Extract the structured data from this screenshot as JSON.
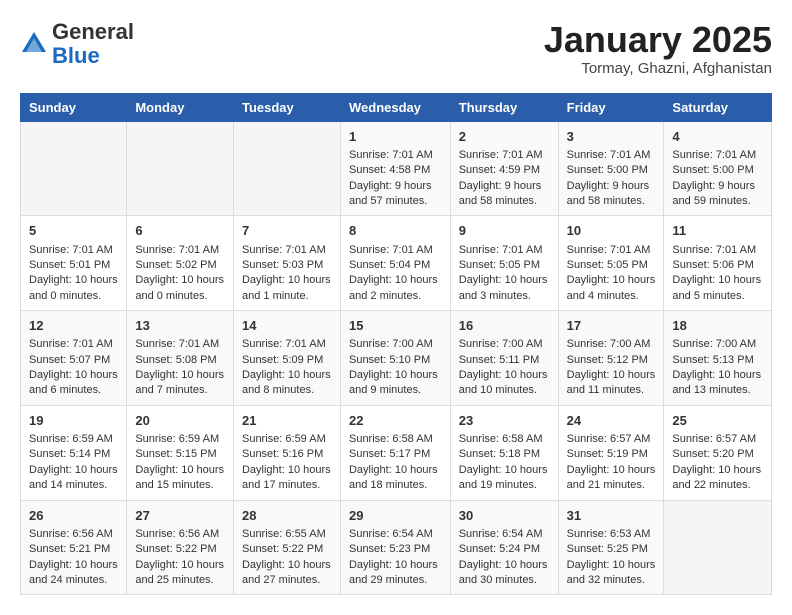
{
  "header": {
    "logo_line1": "General",
    "logo_line2": "Blue",
    "month_title": "January 2025",
    "location": "Tormay, Ghazni, Afghanistan"
  },
  "weekdays": [
    "Sunday",
    "Monday",
    "Tuesday",
    "Wednesday",
    "Thursday",
    "Friday",
    "Saturday"
  ],
  "weeks": [
    [
      {
        "day": "",
        "content": ""
      },
      {
        "day": "",
        "content": ""
      },
      {
        "day": "",
        "content": ""
      },
      {
        "day": "1",
        "content": "Sunrise: 7:01 AM\nSunset: 4:58 PM\nDaylight: 9 hours and 57 minutes."
      },
      {
        "day": "2",
        "content": "Sunrise: 7:01 AM\nSunset: 4:59 PM\nDaylight: 9 hours and 58 minutes."
      },
      {
        "day": "3",
        "content": "Sunrise: 7:01 AM\nSunset: 5:00 PM\nDaylight: 9 hours and 58 minutes."
      },
      {
        "day": "4",
        "content": "Sunrise: 7:01 AM\nSunset: 5:00 PM\nDaylight: 9 hours and 59 minutes."
      }
    ],
    [
      {
        "day": "5",
        "content": "Sunrise: 7:01 AM\nSunset: 5:01 PM\nDaylight: 10 hours and 0 minutes."
      },
      {
        "day": "6",
        "content": "Sunrise: 7:01 AM\nSunset: 5:02 PM\nDaylight: 10 hours and 0 minutes."
      },
      {
        "day": "7",
        "content": "Sunrise: 7:01 AM\nSunset: 5:03 PM\nDaylight: 10 hours and 1 minute."
      },
      {
        "day": "8",
        "content": "Sunrise: 7:01 AM\nSunset: 5:04 PM\nDaylight: 10 hours and 2 minutes."
      },
      {
        "day": "9",
        "content": "Sunrise: 7:01 AM\nSunset: 5:05 PM\nDaylight: 10 hours and 3 minutes."
      },
      {
        "day": "10",
        "content": "Sunrise: 7:01 AM\nSunset: 5:05 PM\nDaylight: 10 hours and 4 minutes."
      },
      {
        "day": "11",
        "content": "Sunrise: 7:01 AM\nSunset: 5:06 PM\nDaylight: 10 hours and 5 minutes."
      }
    ],
    [
      {
        "day": "12",
        "content": "Sunrise: 7:01 AM\nSunset: 5:07 PM\nDaylight: 10 hours and 6 minutes."
      },
      {
        "day": "13",
        "content": "Sunrise: 7:01 AM\nSunset: 5:08 PM\nDaylight: 10 hours and 7 minutes."
      },
      {
        "day": "14",
        "content": "Sunrise: 7:01 AM\nSunset: 5:09 PM\nDaylight: 10 hours and 8 minutes."
      },
      {
        "day": "15",
        "content": "Sunrise: 7:00 AM\nSunset: 5:10 PM\nDaylight: 10 hours and 9 minutes."
      },
      {
        "day": "16",
        "content": "Sunrise: 7:00 AM\nSunset: 5:11 PM\nDaylight: 10 hours and 10 minutes."
      },
      {
        "day": "17",
        "content": "Sunrise: 7:00 AM\nSunset: 5:12 PM\nDaylight: 10 hours and 11 minutes."
      },
      {
        "day": "18",
        "content": "Sunrise: 7:00 AM\nSunset: 5:13 PM\nDaylight: 10 hours and 13 minutes."
      }
    ],
    [
      {
        "day": "19",
        "content": "Sunrise: 6:59 AM\nSunset: 5:14 PM\nDaylight: 10 hours and 14 minutes."
      },
      {
        "day": "20",
        "content": "Sunrise: 6:59 AM\nSunset: 5:15 PM\nDaylight: 10 hours and 15 minutes."
      },
      {
        "day": "21",
        "content": "Sunrise: 6:59 AM\nSunset: 5:16 PM\nDaylight: 10 hours and 17 minutes."
      },
      {
        "day": "22",
        "content": "Sunrise: 6:58 AM\nSunset: 5:17 PM\nDaylight: 10 hours and 18 minutes."
      },
      {
        "day": "23",
        "content": "Sunrise: 6:58 AM\nSunset: 5:18 PM\nDaylight: 10 hours and 19 minutes."
      },
      {
        "day": "24",
        "content": "Sunrise: 6:57 AM\nSunset: 5:19 PM\nDaylight: 10 hours and 21 minutes."
      },
      {
        "day": "25",
        "content": "Sunrise: 6:57 AM\nSunset: 5:20 PM\nDaylight: 10 hours and 22 minutes."
      }
    ],
    [
      {
        "day": "26",
        "content": "Sunrise: 6:56 AM\nSunset: 5:21 PM\nDaylight: 10 hours and 24 minutes."
      },
      {
        "day": "27",
        "content": "Sunrise: 6:56 AM\nSunset: 5:22 PM\nDaylight: 10 hours and 25 minutes."
      },
      {
        "day": "28",
        "content": "Sunrise: 6:55 AM\nSunset: 5:22 PM\nDaylight: 10 hours and 27 minutes."
      },
      {
        "day": "29",
        "content": "Sunrise: 6:54 AM\nSunset: 5:23 PM\nDaylight: 10 hours and 29 minutes."
      },
      {
        "day": "30",
        "content": "Sunrise: 6:54 AM\nSunset: 5:24 PM\nDaylight: 10 hours and 30 minutes."
      },
      {
        "day": "31",
        "content": "Sunrise: 6:53 AM\nSunset: 5:25 PM\nDaylight: 10 hours and 32 minutes."
      },
      {
        "day": "",
        "content": ""
      }
    ]
  ]
}
